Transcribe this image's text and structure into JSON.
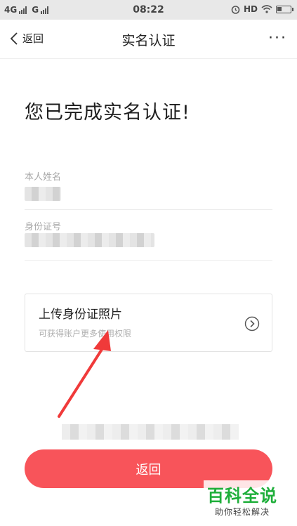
{
  "status_bar": {
    "network_1": "4G",
    "network_2": "G",
    "time": "08:22",
    "hd": "HD"
  },
  "nav": {
    "back_label": "返回",
    "title": "实名认证",
    "more_label": "···"
  },
  "headline": "您已完成实名认证!",
  "fields": [
    {
      "label": "本人姓名"
    },
    {
      "label": "身份证号"
    }
  ],
  "upload": {
    "title": "上传身份证照片",
    "subtitle": "可获得账户更多使用权限"
  },
  "button": {
    "label": "返回"
  },
  "watermark": {
    "main": "百科全说",
    "sub": "助你轻松解决"
  },
  "colors": {
    "accent": "#f8545a",
    "annotation_arrow": "#f03a3a",
    "watermark_green": "#1eae3a"
  }
}
